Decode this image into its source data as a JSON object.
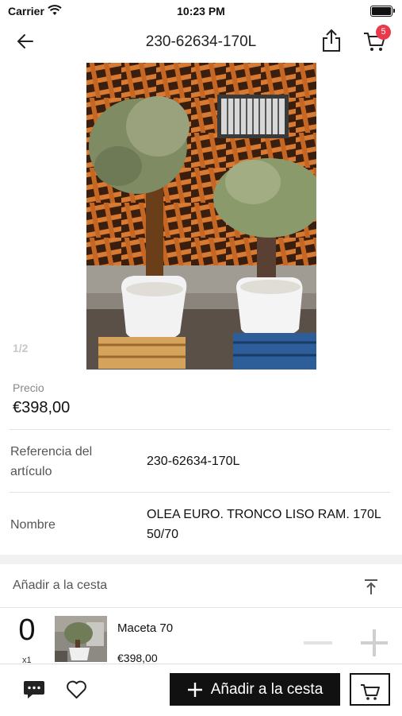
{
  "status": {
    "carrier": "Carrier",
    "time": "10:23 PM"
  },
  "nav": {
    "title": "230-62634-170L",
    "cart_badge": "5"
  },
  "gallery": {
    "indicator": "1/2"
  },
  "price": {
    "label": "Precio",
    "value": "€398,00"
  },
  "details": {
    "ref_label_1": "Referencia del",
    "ref_label_2": "artículo",
    "ref_value": "230-62634-170L",
    "name_label": "Nombre",
    "name_value_1": "OLEA EURO. TRONCO LISO RAM. 170L",
    "name_value_2": "50/70"
  },
  "cart_section": {
    "header": "Añadir a la cesta",
    "quantity": "0",
    "multiplier": "x1",
    "item_name": "Maceta 70",
    "item_price": "€398,00"
  },
  "bottom": {
    "add_label": "Añadir a la cesta"
  },
  "colors": {
    "badge": "#e83a4a",
    "primary": "#111111"
  },
  "icons": [
    "back-arrow-icon",
    "share-icon",
    "cart-icon",
    "chat-icon",
    "heart-icon",
    "plus-icon",
    "minus-icon",
    "scroll-top-icon"
  ]
}
